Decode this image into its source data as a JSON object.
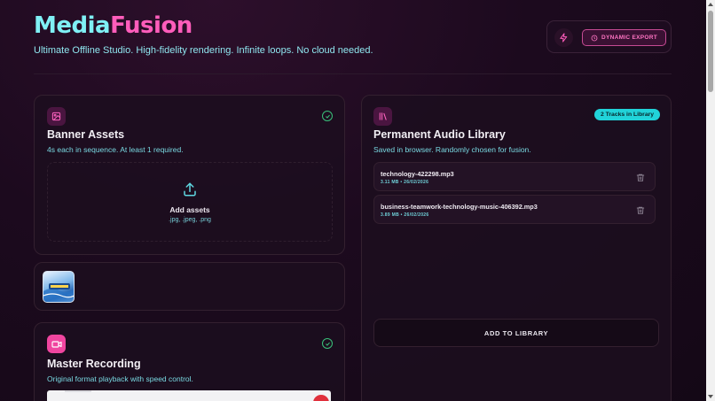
{
  "header": {
    "brand_part1": "Media",
    "brand_part2": "Fusion",
    "tagline": "Ultimate Offline Studio. High-fidelity rendering. Infinite loops. No cloud needed.",
    "export_label": "DYNAMIC EXPORT"
  },
  "banner": {
    "title": "Banner Assets",
    "subtitle": "4s each in sequence. At least 1 required.",
    "dropzone_title": "Add assets",
    "dropzone_formats": ".jpg, .jpeg, .png"
  },
  "recording": {
    "title": "Master Recording",
    "subtitle": "Original format playback with speed control."
  },
  "library": {
    "title": "Permanent Audio Library",
    "subtitle": "Saved in browser. Randomly chosen for fusion.",
    "badge": "2 Tracks in Library",
    "tracks": [
      {
        "name": "technology-422298.mp3",
        "meta": "3.11 MB • 26/02/2026"
      },
      {
        "name": "business-teamwork-technology-music-406392.mp3",
        "meta": "3.89 MB • 26/02/2026"
      }
    ],
    "add_label": "ADD TO LIBRARY"
  },
  "colors": {
    "brand_cyan": "#7ff0f5",
    "brand_pink": "#ff5dbb",
    "accent_teal": "#21d3d9",
    "success_green": "#39c27a"
  },
  "icons": [
    "bolt-icon",
    "clock-icon",
    "image-icon",
    "check-circle-icon",
    "upload-icon",
    "library-icon",
    "trash-icon",
    "video-icon"
  ]
}
